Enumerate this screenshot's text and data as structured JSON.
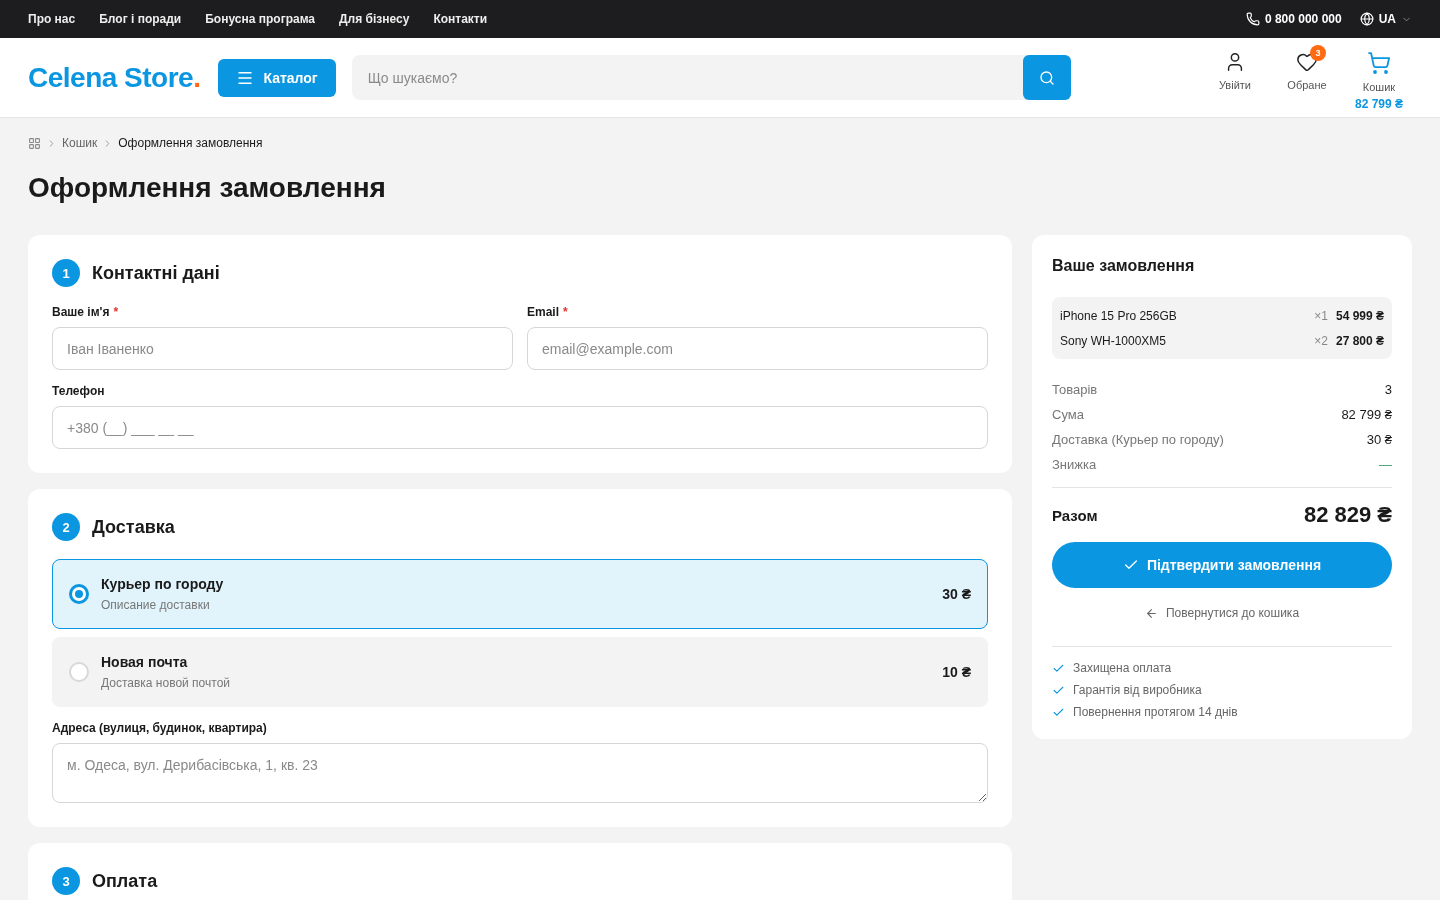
{
  "top_bar": {
    "links": [
      "Про нас",
      "Блог і поради",
      "Бонусна програма",
      "Для бізнесу",
      "Контакти"
    ],
    "phone": "0 800 000 000",
    "language": "UA"
  },
  "header": {
    "logo": {
      "name": "Celena Store",
      "dot": "."
    },
    "catalog_button": "Каталог",
    "search": {
      "placeholder": "Що шукаємо?"
    },
    "actions": [
      {
        "kind": "user",
        "label": "Увійти"
      },
      {
        "kind": "favorites",
        "label": "Обране",
        "badge": "3"
      },
      {
        "kind": "cart",
        "label": "Кошик",
        "amount": "82 799 ₴"
      }
    ]
  },
  "breadcrumbs": [
    "Кошик",
    "Оформлення замовлення"
  ],
  "page_title": "Оформлення замовлення",
  "contact_section": {
    "number": "1",
    "title": "Контактні дані",
    "fields": [
      {
        "label": "Ваше ім'я",
        "required_mark": "*",
        "placeholder": "Іван Іваненко"
      },
      {
        "label": "Email",
        "required_mark": "*",
        "placeholder": "email@example.com"
      },
      {
        "label": "Телефон",
        "placeholder": "+380 (__) ___ __ __"
      }
    ]
  },
  "delivery_section": {
    "number": "2",
    "title": "Доставка",
    "options": [
      {
        "title": "Курьер по городу",
        "description": "Описание доставки",
        "price": "30 ₴",
        "selected": true
      },
      {
        "title": "Новая почта",
        "description": "Доставка новой почтой",
        "price": "10 ₴",
        "selected": false
      }
    ],
    "address": {
      "label": "Адреса (вулиця, будинок, квартира)",
      "placeholder": "м. Одеса, вул. Дерибасівська, 1, кв. 23"
    }
  },
  "payment_section": {
    "number": "3",
    "title": "Оплата"
  },
  "order_summary": {
    "title": "Ваше замовлення",
    "items": [
      {
        "name": "iPhone 15 Pro 256GB",
        "quantity": "×1",
        "price": "54 999 ₴"
      },
      {
        "name": "Sony WH-1000XM5",
        "quantity": "×2",
        "price": "27 800 ₴"
      }
    ],
    "rows": [
      {
        "label": "Товарів",
        "value": "3",
        "kind": "plain"
      },
      {
        "label": "Сума",
        "value": "82 799 ₴",
        "kind": "plain"
      },
      {
        "label": "Доставка (Курьер по городу)",
        "value": "30 ₴",
        "kind": "plain"
      },
      {
        "label": "Знижка",
        "value": "—",
        "kind": "discount"
      }
    ],
    "total": {
      "label": "Разом",
      "value": "82 829 ₴"
    },
    "confirm_button": "Підтвердити замовлення",
    "back_link": "Повернутися до кошика",
    "guarantees": [
      "Захищена оплата",
      "Гарантія від виробника",
      "Повернення протягом 14 днів"
    ]
  }
}
